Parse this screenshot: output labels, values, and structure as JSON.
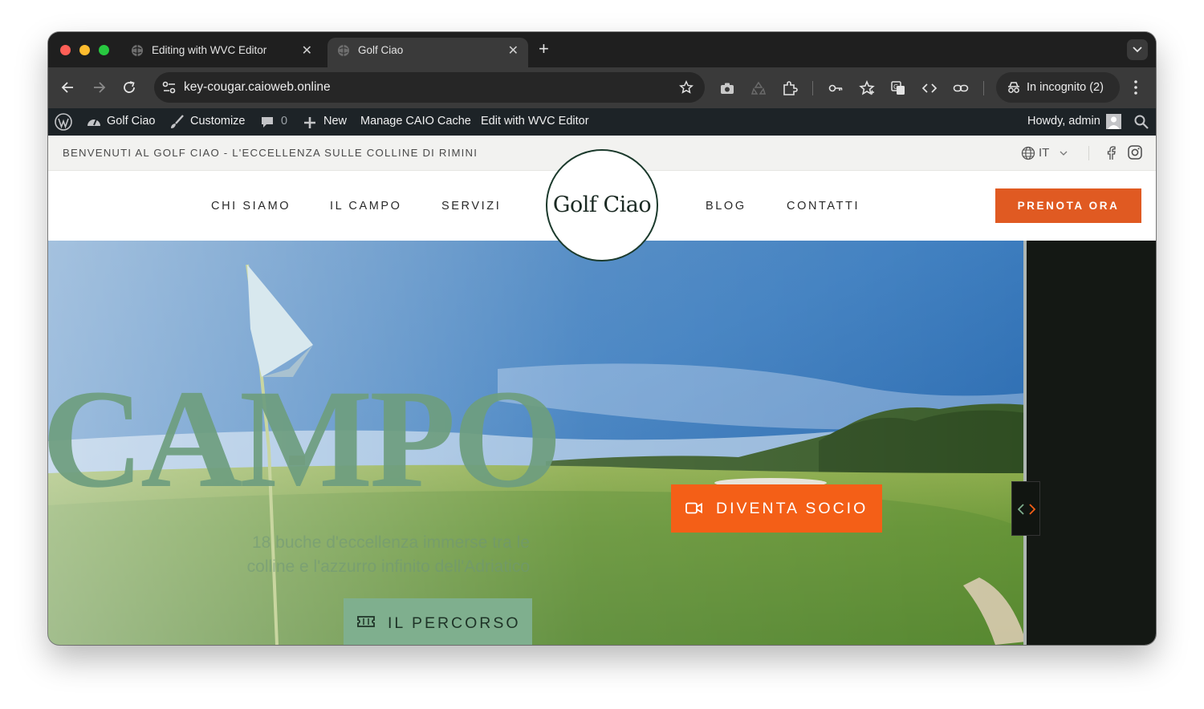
{
  "browser": {
    "tabs": [
      {
        "title": "Editing with WVC Editor",
        "active": false
      },
      {
        "title": "Golf Ciao",
        "active": true
      }
    ],
    "url": "key-cougar.caioweb.online",
    "incognito_label": "In incognito (2)"
  },
  "admin_bar": {
    "site_name": "Golf Ciao",
    "customize": "Customize",
    "comments_count": "0",
    "new": "New",
    "manage_cache": "Manage CAIO Cache",
    "edit_wvc": "Edit with WVC Editor",
    "howdy": "Howdy, admin"
  },
  "site": {
    "welcome_text": "BENVENUTI AL GOLF CIAO - L'ECCELLENZA SULLE COLLINE DI RIMINI",
    "language": "IT",
    "nav": {
      "chi_siamo": "CHI SIAMO",
      "il_campo": "IL CAMPO",
      "servizi": "SERVIZI",
      "blog": "BLOG",
      "contatti": "CONTATTI"
    },
    "logo_text": "Golf Ciao",
    "cta": "PRENOTA ORA",
    "hero": {
      "big_word": "CAMPO",
      "subtitle_line1": "18 buche d'eccellenza immerse tra le",
      "subtitle_line2": "colline e l'azzurro infinito dell'Adriatico",
      "btn_socio": "DIVENTA SOCIO",
      "btn_percorso": "IL PERCORSO"
    }
  },
  "colors": {
    "accent_orange": "#f45f17",
    "cta_orange": "#e05a22",
    "brand_green": "#7faf8e",
    "admin_bar": "#1d2327"
  }
}
